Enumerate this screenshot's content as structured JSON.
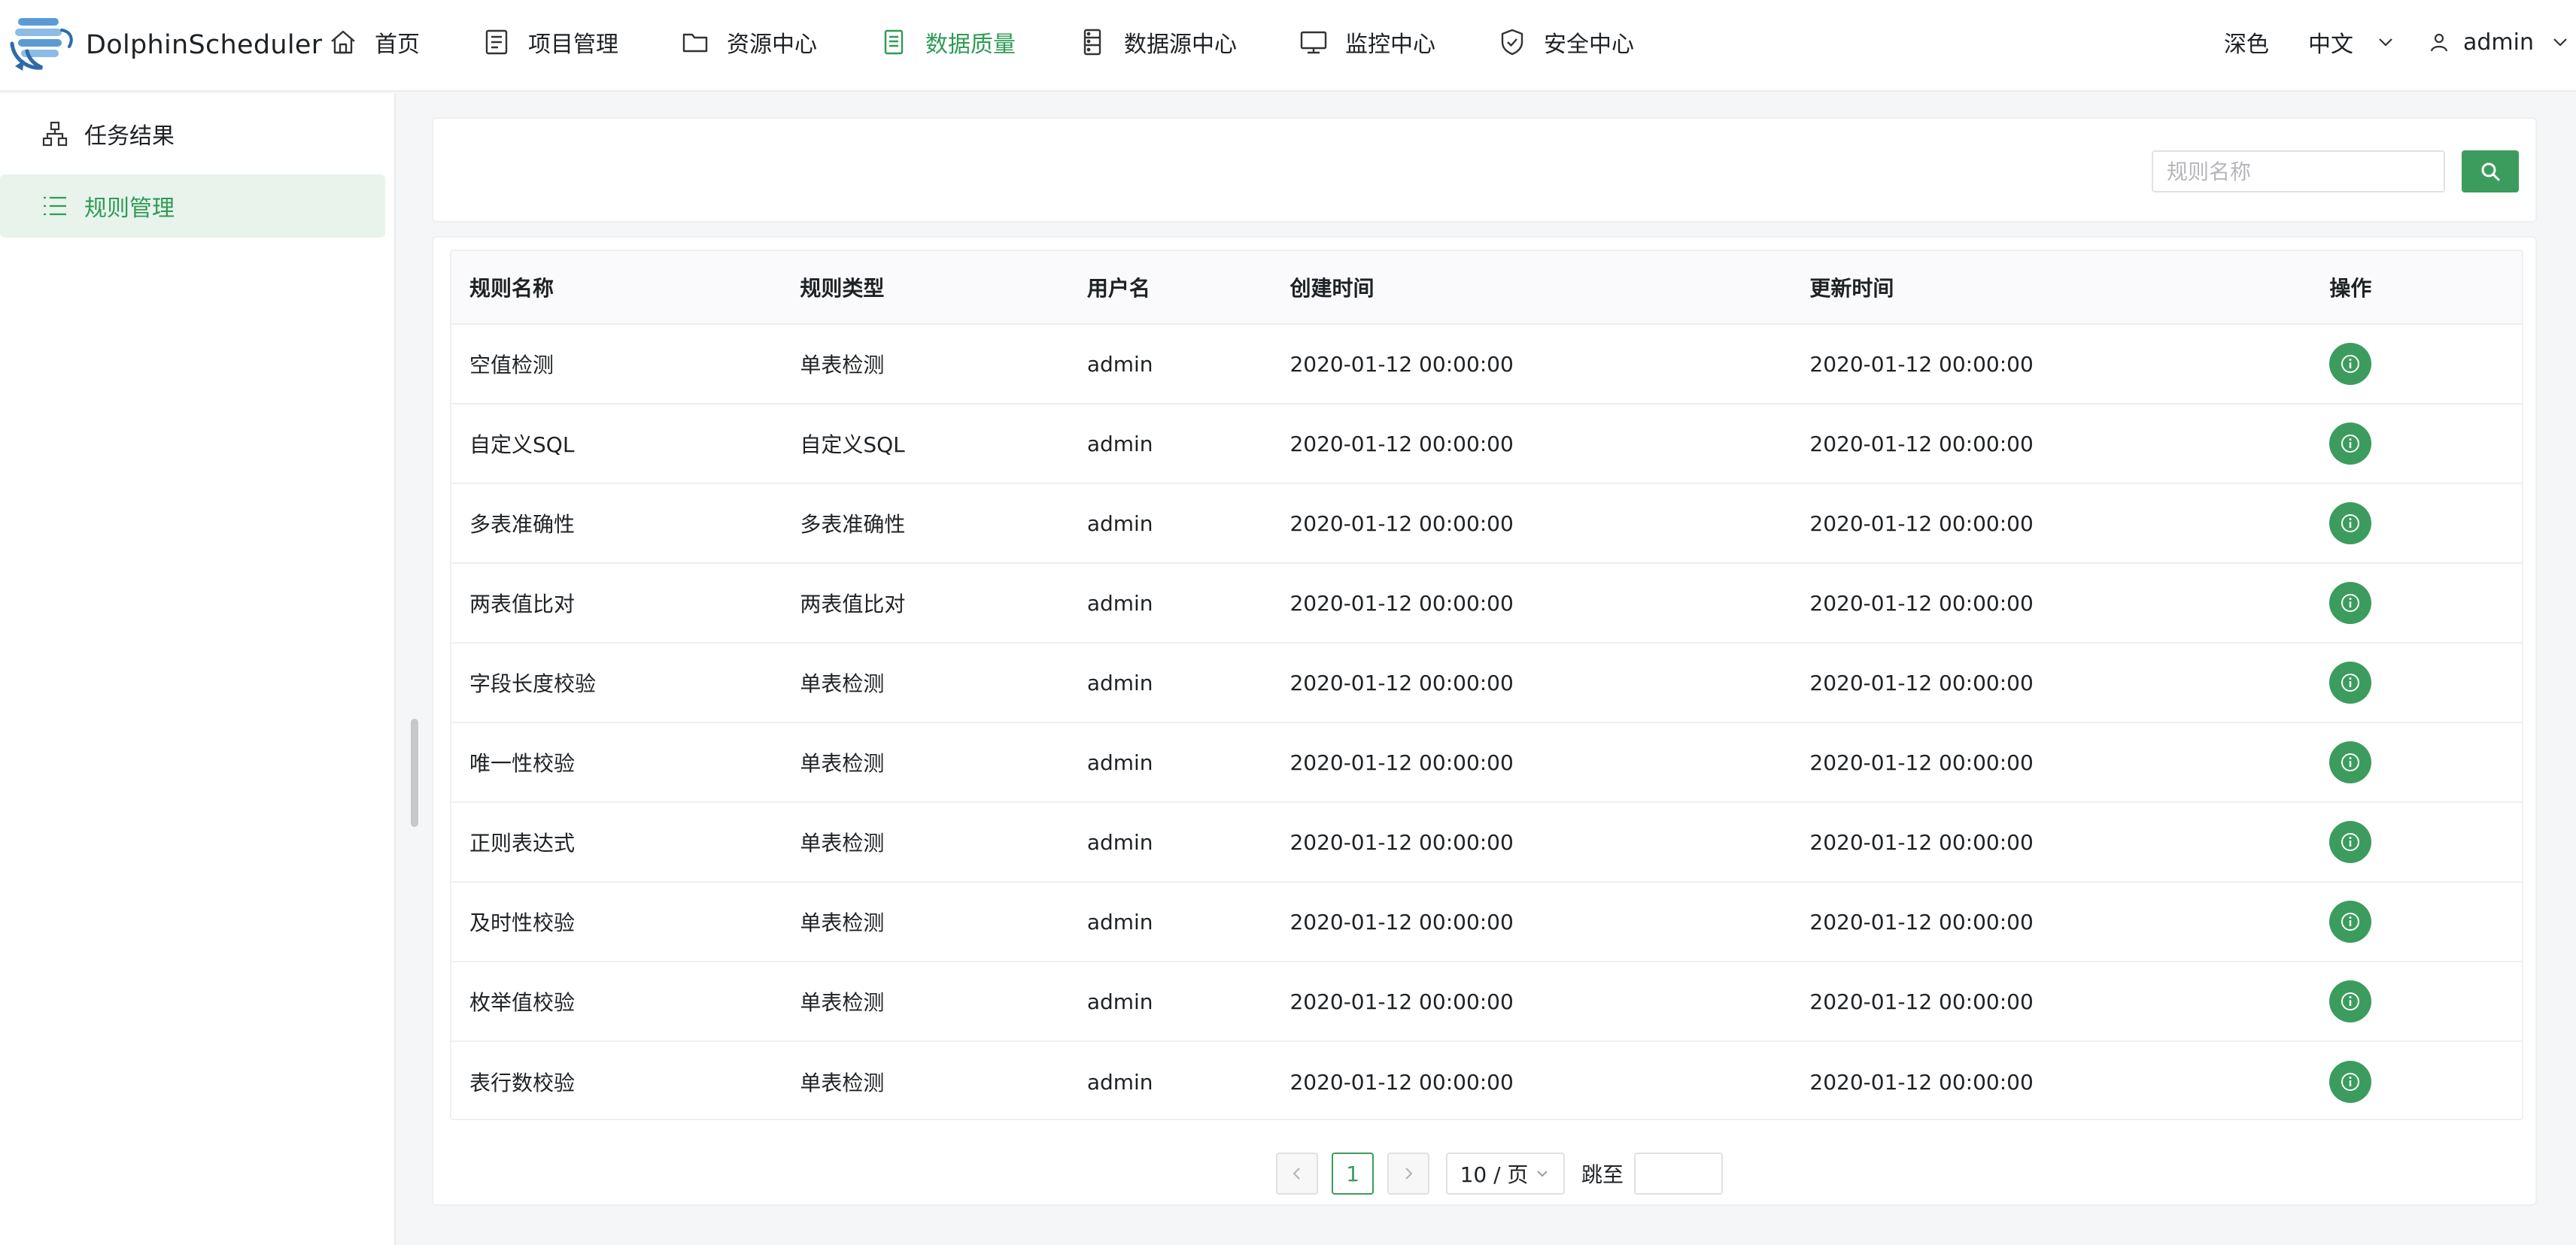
{
  "app": {
    "name": "DolphinScheduler"
  },
  "nav": [
    {
      "label": "首页",
      "icon": "home-icon"
    },
    {
      "label": "项目管理",
      "icon": "project-icon"
    },
    {
      "label": "资源中心",
      "icon": "folder-icon"
    },
    {
      "label": "数据质量",
      "icon": "data-quality-icon",
      "active": true
    },
    {
      "label": "数据源中心",
      "icon": "datasource-icon"
    },
    {
      "label": "监控中心",
      "icon": "monitor-icon"
    },
    {
      "label": "安全中心",
      "icon": "shield-icon"
    }
  ],
  "header_right": {
    "theme": "深色",
    "language": "中文",
    "user": "admin"
  },
  "sidebar": [
    {
      "label": "任务结果",
      "icon": "task-result-icon"
    },
    {
      "label": "规则管理",
      "icon": "list-icon",
      "active": true
    }
  ],
  "search": {
    "placeholder": "规则名称",
    "value": ""
  },
  "table": {
    "columns": [
      "规则名称",
      "规则类型",
      "用户名",
      "创建时间",
      "更新时间",
      "操作"
    ],
    "rows": [
      [
        "空值检测",
        "单表检测",
        "admin",
        "2020-01-12 00:00:00",
        "2020-01-12 00:00:00"
      ],
      [
        "自定义SQL",
        "自定义SQL",
        "admin",
        "2020-01-12 00:00:00",
        "2020-01-12 00:00:00"
      ],
      [
        "多表准确性",
        "多表准确性",
        "admin",
        "2020-01-12 00:00:00",
        "2020-01-12 00:00:00"
      ],
      [
        "两表值比对",
        "两表值比对",
        "admin",
        "2020-01-12 00:00:00",
        "2020-01-12 00:00:00"
      ],
      [
        "字段长度校验",
        "单表检测",
        "admin",
        "2020-01-12 00:00:00",
        "2020-01-12 00:00:00"
      ],
      [
        "唯一性校验",
        "单表检测",
        "admin",
        "2020-01-12 00:00:00",
        "2020-01-12 00:00:00"
      ],
      [
        "正则表达式",
        "单表检测",
        "admin",
        "2020-01-12 00:00:00",
        "2020-01-12 00:00:00"
      ],
      [
        "及时性校验",
        "单表检测",
        "admin",
        "2020-01-12 00:00:00",
        "2020-01-12 00:00:00"
      ],
      [
        "枚举值校验",
        "单表检测",
        "admin",
        "2020-01-12 00:00:00",
        "2020-01-12 00:00:00"
      ],
      [
        "表行数校验",
        "单表检测",
        "admin",
        "2020-01-12 00:00:00",
        "2020-01-12 00:00:00"
      ]
    ]
  },
  "pagination": {
    "current_page": "1",
    "page_size": "10 / 页",
    "jump_label": "跳至"
  },
  "colors": {
    "accent": "#3c9c5e",
    "active_text": "#2f9b56",
    "active_bg": "#e8f3ec"
  }
}
